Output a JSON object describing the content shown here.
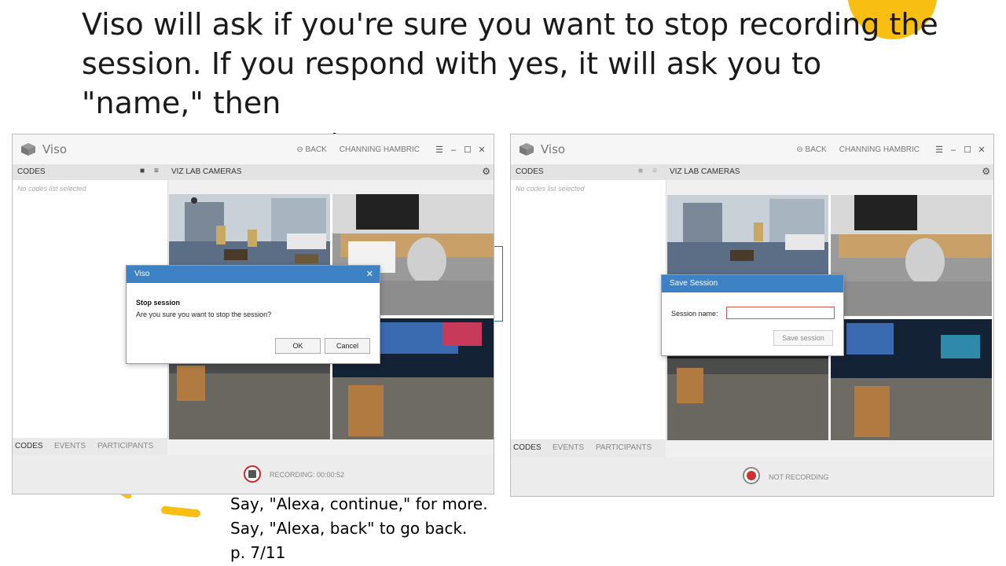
{
  "slide": {
    "title_line1": "Viso will ask if you're sure you want to stop recording the",
    "title_line2": "session. If you respond with yes, it will ask you to \"name,\" then",
    "title_line3": "\"save\" your session.",
    "footer_line1": "Say, \"Alexa, continue,\" for more.",
    "footer_line2": "Say, \"Alexa, back\" to go back.",
    "footer_line3": "p. 7/11",
    "accent_color": "#f9be12"
  },
  "window_left": {
    "app_name": "Viso",
    "back_label": "BACK",
    "user_name": "CHANNING HAMBRIC",
    "codes_header": "CODES",
    "cameras_header": "VIZ LAB CAMERAS",
    "empty_codes": "No codes list selected",
    "tabs": [
      "CODES",
      "EVENTS",
      "PARTICIPANTS"
    ],
    "status": "RECORDING: 00:00:52",
    "dialog": {
      "title": "Viso",
      "heading": "Stop session",
      "message": "Are you sure you want to stop the session?",
      "ok_label": "OK",
      "cancel_label": "Cancel"
    }
  },
  "window_right": {
    "app_name": "Viso",
    "back_label": "BACK",
    "user_name": "CHANNING HAMBRIC",
    "codes_header": "CODES",
    "cameras_header": "VIZ LAB CAMERAS",
    "empty_codes": "No codes list selected",
    "tabs": [
      "CODES",
      "EVENTS",
      "PARTICIPANTS"
    ],
    "status": "NOT RECORDING",
    "dialog": {
      "title": "Save Session",
      "field_label": "Session name:",
      "field_value": "",
      "save_label": "Save session"
    }
  },
  "icons": {
    "logo": "cube-logo-icon",
    "back": "back-arrow-icon",
    "menu": "hamburger-menu-icon",
    "minimize": "minimize-icon",
    "maximize": "maximize-icon",
    "close": "close-icon",
    "chat": "chat-icon",
    "list": "list-icon",
    "settings": "gear-icon"
  },
  "colors": {
    "dialog_title_bar": "#3d82c4",
    "record_red": "#c62828",
    "error_border": "#d9534f"
  }
}
